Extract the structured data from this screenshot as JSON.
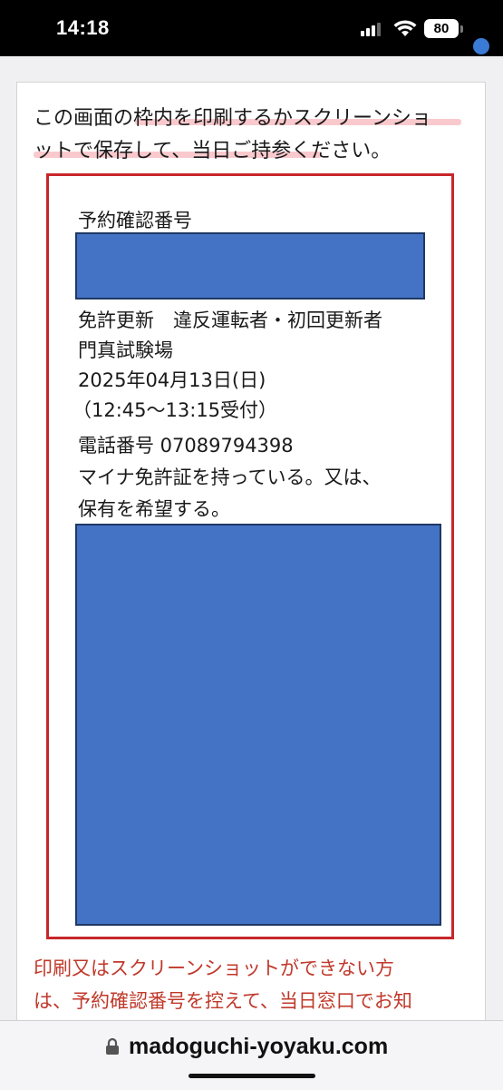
{
  "status_bar": {
    "time": "14:18",
    "battery": "80",
    "icons": [
      "signal-icon",
      "wifi-icon",
      "battery-icon"
    ]
  },
  "card": {
    "intro_line1": "この画面の枠内を印刷するかスクリーンショ",
    "intro_line2": "ットで保存して、当日ご持参ください。",
    "highlight_color": "#f9c9cd",
    "frame_color": "#c8262b",
    "redaction_color": "#4472c4",
    "reservation": {
      "number_label": "予約確認番号",
      "license_type": "免許更新　違反運転者・初回更新者",
      "location": "門真試験場",
      "date": "2025年04月13日(日)",
      "reception_time": "（12:45～13:15受付）",
      "phone": "電話番号 07089794398",
      "my_number_line1": "マイナ免許証を持っている。又は、",
      "my_number_line2": "保有を希望する。"
    },
    "notice_line1": "印刷又はスクリーンショットができない方",
    "notice_line2": "は、予約確認番号を控えて、当日窓口でお知",
    "notice_color": "#c0392b"
  },
  "browser": {
    "url": "madoguchi-yoyaku.com"
  }
}
